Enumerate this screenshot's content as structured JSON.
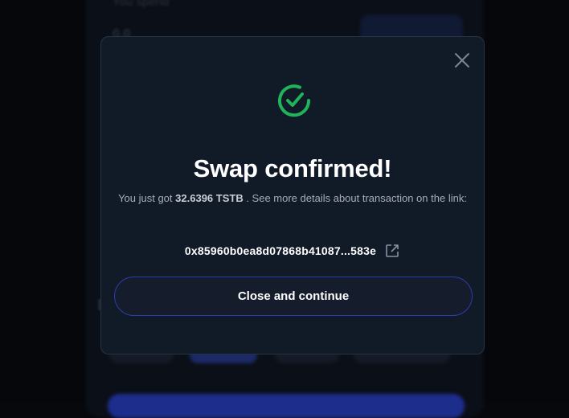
{
  "background": {
    "label_you_spend": "You spend",
    "amount": "0.0"
  },
  "modal": {
    "title": "Swap confirmed!",
    "description_prefix": "You just got",
    "amount_received": "32.6396 TSTB",
    "description_suffix": ". See more details about transaction on the link:",
    "tx_hash": "0x85960b0ea8d07868b41087...583e",
    "cta_label": "Close and continue"
  },
  "icons": {
    "success": "check-circle-icon",
    "close": "close-icon",
    "external_link": "external-link-icon"
  },
  "colors": {
    "success_green": "#1fb35a",
    "cta_border": "#2b3ea8",
    "modal_bg": "#111a27"
  }
}
